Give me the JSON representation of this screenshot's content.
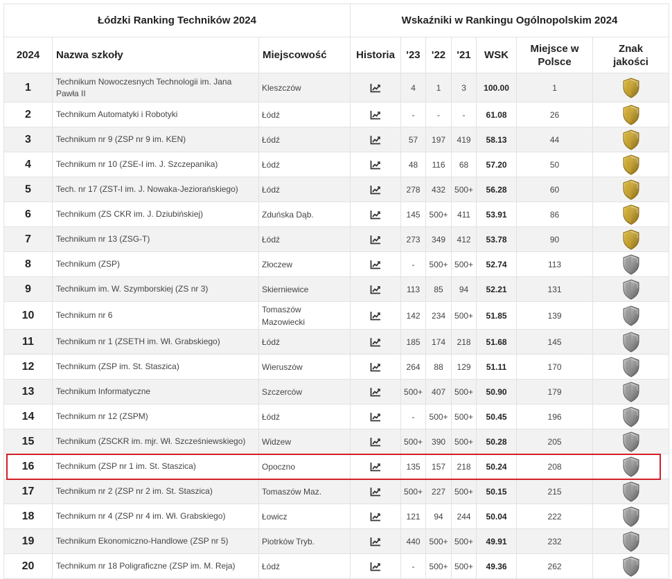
{
  "table": {
    "group_headers": {
      "left": "Łódzki Ranking Techników 2024",
      "right": "Wskaźniki w Rankingu Ogólnopolskim 2024"
    },
    "columns": {
      "rank": "2024",
      "name": "Nazwa szkoły",
      "city": "Miejscowość",
      "history": "Historia",
      "y23": "'23",
      "y22": "'22",
      "y21": "'21",
      "wsk": "WSK",
      "poland_line1": "Miejsce w",
      "poland_line2": "Polsce",
      "badge_line1": "Znak",
      "badge_line2": "jakości"
    },
    "icons": {
      "history": "trend-chart-icon",
      "badge": "shield-icon"
    },
    "colors": {
      "gold": "#c9a227",
      "silver": "#8a8a8a",
      "highlight": "#d21f27"
    },
    "rows": [
      {
        "rank": "1",
        "name_lines": [
          "Technikum Nowoczesnych Technologii im. Jana",
          "Pawła II"
        ],
        "city_lines": [
          "Kleszczów"
        ],
        "y23": "4",
        "y22": "1",
        "y21": "3",
        "wsk": "100.00",
        "pl": "1",
        "badge": "gold"
      },
      {
        "rank": "2",
        "name_lines": [
          "Technikum Automatyki i Robotyki"
        ],
        "city_lines": [
          "Łódź"
        ],
        "y23": "-",
        "y22": "-",
        "y21": "-",
        "wsk": "61.08",
        "pl": "26",
        "badge": "gold"
      },
      {
        "rank": "3",
        "name_lines": [
          "Technikum nr 9 (ZSP nr 9 im. KEN)"
        ],
        "city_lines": [
          "Łódź"
        ],
        "y23": "57",
        "y22": "197",
        "y21": "419",
        "wsk": "58.13",
        "pl": "44",
        "badge": "gold"
      },
      {
        "rank": "4",
        "name_lines": [
          "Technikum nr 10 (ZSE-I im. J. Szczepanika)"
        ],
        "city_lines": [
          "Łódź"
        ],
        "y23": "48",
        "y22": "116",
        "y21": "68",
        "wsk": "57.20",
        "pl": "50",
        "badge": "gold"
      },
      {
        "rank": "5",
        "name_lines": [
          "Tech. nr 17 (ZST-I im. J. Nowaka-Jeziorańskiego)"
        ],
        "city_lines": [
          "Łódź"
        ],
        "y23": "278",
        "y22": "432",
        "y21": "500+",
        "wsk": "56.28",
        "pl": "60",
        "badge": "gold"
      },
      {
        "rank": "6",
        "name_lines": [
          "Technikum (ZS CKR im. J. Dziubińskiej)"
        ],
        "city_lines": [
          "Zduńska Dąb."
        ],
        "y23": "145",
        "y22": "500+",
        "y21": "411",
        "wsk": "53.91",
        "pl": "86",
        "badge": "gold"
      },
      {
        "rank": "7",
        "name_lines": [
          "Technikum nr 13 (ZSG-T)"
        ],
        "city_lines": [
          "Łódź"
        ],
        "y23": "273",
        "y22": "349",
        "y21": "412",
        "wsk": "53.78",
        "pl": "90",
        "badge": "gold"
      },
      {
        "rank": "8",
        "name_lines": [
          "Technikum (ZSP)"
        ],
        "city_lines": [
          "Złoczew"
        ],
        "y23": "-",
        "y22": "500+",
        "y21": "500+",
        "wsk": "52.74",
        "pl": "113",
        "badge": "silver"
      },
      {
        "rank": "9",
        "name_lines": [
          "Technikum im. W. Szymborskiej (ZS nr 3)"
        ],
        "city_lines": [
          "Skierniewice"
        ],
        "y23": "113",
        "y22": "85",
        "y21": "94",
        "wsk": "52.21",
        "pl": "131",
        "badge": "silver"
      },
      {
        "rank": "10",
        "name_lines": [
          "Technikum nr 6"
        ],
        "city_lines": [
          "Tomaszów",
          "Mazowiecki"
        ],
        "y23": "142",
        "y22": "234",
        "y21": "500+",
        "wsk": "51.85",
        "pl": "139",
        "badge": "silver"
      },
      {
        "rank": "11",
        "name_lines": [
          "Technikum nr 1 (ZSETH im. Wł. Grabskiego)"
        ],
        "city_lines": [
          "Łódź"
        ],
        "y23": "185",
        "y22": "174",
        "y21": "218",
        "wsk": "51.68",
        "pl": "145",
        "badge": "silver"
      },
      {
        "rank": "12",
        "name_lines": [
          "Technikum (ZSP im. St. Staszica)"
        ],
        "city_lines": [
          "Wieruszów"
        ],
        "y23": "264",
        "y22": "88",
        "y21": "129",
        "wsk": "51.11",
        "pl": "170",
        "badge": "silver"
      },
      {
        "rank": "13",
        "name_lines": [
          "Technikum Informatyczne"
        ],
        "city_lines": [
          "Szczerców"
        ],
        "y23": "500+",
        "y22": "407",
        "y21": "500+",
        "wsk": "50.90",
        "pl": "179",
        "badge": "silver"
      },
      {
        "rank": "14",
        "name_lines": [
          "Technikum nr 12 (ZSPM)"
        ],
        "city_lines": [
          "Łódź"
        ],
        "y23": "-",
        "y22": "500+",
        "y21": "500+",
        "wsk": "50.45",
        "pl": "196",
        "badge": "silver"
      },
      {
        "rank": "15",
        "name_lines": [
          "Technikum (ZSCKR im. mjr. Wł. Szcześniewskiego)"
        ],
        "city_lines": [
          "Widzew"
        ],
        "y23": "500+",
        "y22": "390",
        "y21": "500+",
        "wsk": "50.28",
        "pl": "205",
        "badge": "silver"
      },
      {
        "rank": "16",
        "name_lines": [
          "Technikum (ZSP nr 1 im. St. Staszica)"
        ],
        "city_lines": [
          "Opoczno"
        ],
        "y23": "135",
        "y22": "157",
        "y21": "218",
        "wsk": "50.24",
        "pl": "208",
        "badge": "silver",
        "highlighted": true
      },
      {
        "rank": "17",
        "name_lines": [
          "Technikum nr 2 (ZSP nr 2 im. St. Staszica)"
        ],
        "city_lines": [
          "Tomaszów Maz."
        ],
        "y23": "500+",
        "y22": "227",
        "y21": "500+",
        "wsk": "50.15",
        "pl": "215",
        "badge": "silver"
      },
      {
        "rank": "18",
        "name_lines": [
          "Technikum nr 4 (ZSP nr 4 im. Wł. Grabskiego)"
        ],
        "city_lines": [
          "Łowicz"
        ],
        "y23": "121",
        "y22": "94",
        "y21": "244",
        "wsk": "50.04",
        "pl": "222",
        "badge": "silver"
      },
      {
        "rank": "19",
        "name_lines": [
          "Technikum Ekonomiczno-Handlowe (ZSP nr 5)"
        ],
        "city_lines": [
          "Piotrków Tryb."
        ],
        "y23": "440",
        "y22": "500+",
        "y21": "500+",
        "wsk": "49.91",
        "pl": "232",
        "badge": "silver"
      },
      {
        "rank": "20",
        "name_lines": [
          "Technikum nr 18 Poligraficzne (ZSP im. M. Reja)"
        ],
        "city_lines": [
          "Łódź"
        ],
        "y23": "-",
        "y22": "500+",
        "y21": "500+",
        "wsk": "49.36",
        "pl": "262",
        "badge": "silver"
      }
    ]
  }
}
